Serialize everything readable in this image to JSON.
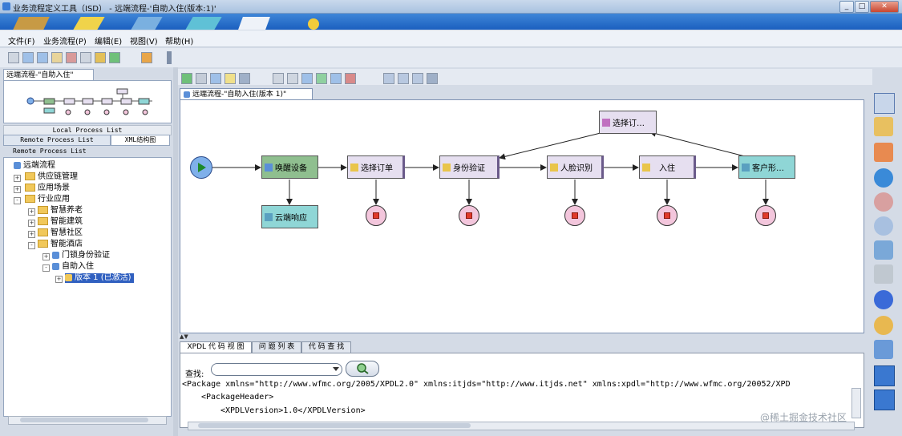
{
  "window": {
    "title": "业务流程定义工具（ISD） - 远端流程-'自助入住(版本:1)'"
  },
  "menu": [
    "文件(F)",
    "业务流程(P)",
    "编辑(E)",
    "视图(V)",
    "帮助(H)"
  ],
  "left": {
    "tab_label": "远端流程-\"自助入住\"",
    "local_header": "Local Process List",
    "tabs": [
      "Remote Process List",
      "XML结构图"
    ],
    "remote_header": "Remote Process List",
    "tree": [
      {
        "label": "远端流程",
        "expander": ""
      },
      {
        "label": "供应链管理",
        "expander": "+"
      },
      {
        "label": "应用场景",
        "expander": "+"
      },
      {
        "label": "行业应用",
        "expander": "-"
      },
      {
        "label": "智慧养老",
        "expander": "+"
      },
      {
        "label": "智能建筑",
        "expander": "+"
      },
      {
        "label": "智慧社区",
        "expander": "+"
      },
      {
        "label": "智能酒店",
        "expander": "-"
      },
      {
        "label": "门锁身份验证",
        "expander": "+"
      },
      {
        "label": "自助入住",
        "expander": "-"
      },
      {
        "label": "版本 1 (已激活)",
        "expander": "+"
      }
    ]
  },
  "editor": {
    "doc_tab": "远端流程-\"自助入住(版本 1)\"",
    "nodes": [
      {
        "id": "wake",
        "label": "唤醒设备",
        "color": "#8fbf8f"
      },
      {
        "id": "cloud",
        "label": "云端响应",
        "color": "#8fd6d6"
      },
      {
        "id": "order",
        "label": "选择订单",
        "color": "#e6dff0"
      },
      {
        "id": "auth",
        "label": "身份验证",
        "color": "#e6dff0"
      },
      {
        "id": "face",
        "label": "人脸识别",
        "color": "#e6dff0"
      },
      {
        "id": "checkin",
        "label": "入住",
        "color": "#e6dff0"
      },
      {
        "id": "guest",
        "label": "客户形…",
        "color": "#8fd6d6"
      },
      {
        "id": "select",
        "label": "选择订…",
        "color": "#e6dff0"
      }
    ]
  },
  "bottom": {
    "tabs": [
      "XPDL 代 码 视 图",
      "问 题 列 表",
      "代 码 查 找"
    ],
    "find_label": "查找:",
    "code_lines": [
      "<Package xmlns=\"http://www.wfmc.org/2005/XPDL2.0\" xmlns:itjds=\"http://www.itjds.net\" xmlns:xpdl=\"http://www.wfmc.org/20052/XPD",
      "<PackageHeader>",
      "<XPDLVersion>1.0</XPDLVersion>"
    ]
  },
  "watermark": "@稀土掘金技术社区"
}
